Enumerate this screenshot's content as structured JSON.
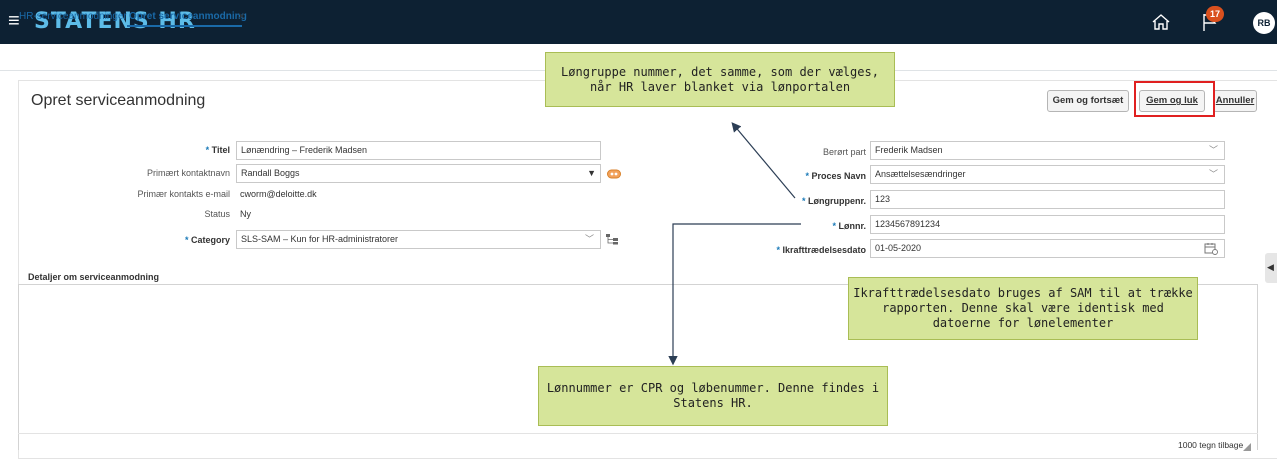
{
  "header": {
    "menu_icon": "hamburger-icon",
    "brand": "STATENS HR",
    "home_icon": "home-icon",
    "notification_icon": "flag-icon",
    "notification_count": "17",
    "user_initials": "RB",
    "colors": {
      "bar": "#0d2133",
      "brand": "#5dbce8",
      "badge": "#d9501e"
    }
  },
  "tabs": [
    {
      "label": "HR-serviceanmodninger"
    },
    {
      "label": "Opret serviceanmodning",
      "close": "×"
    }
  ],
  "page": {
    "title": "Opret serviceanmodning",
    "buttons": {
      "save_continue": "Gem og fortsæt",
      "save_close": "Gem og luk",
      "cancel": "Annuller"
    }
  },
  "form_left": {
    "title_label": "Titel",
    "title_value": "Lønændring – Frederik Madsen",
    "contact_label": "Primært kontaktnavn",
    "contact_value": "Randall Boggs",
    "email_label": "Primær kontakts e-mail",
    "email_value": "cworm@deloitte.dk",
    "status_label": "Status",
    "status_value": "Ny",
    "category_label": "Category",
    "category_value": "SLS-SAM – Kun for HR-administratorer"
  },
  "form_right": {
    "party_label": "Berørt part",
    "party_value": "Frederik Madsen",
    "process_label": "Proces Navn",
    "process_value": "Ansættelsesændringer",
    "salary_group_label": "Løngruppenr.",
    "salary_group_value": "123",
    "salary_no_label": "Lønnr.",
    "salary_no_value": "1234567891234",
    "effective_date_label": "Ikrafttrædelsesdato",
    "effective_date_value": "01-05-2020"
  },
  "details": {
    "label": "Detaljer om serviceanmodning",
    "counter": "1000 tegn tilbage"
  },
  "callouts": {
    "salary_group": "Løngruppe nummer, det samme, som der vælges, når HR laver blanket via lønportalen",
    "effective_date": "Ikrafttrædelsesdato bruges af SAM til at trække rapporten. Denne skal være identisk med datoerne for lønelementer",
    "salary_number": "Lønnummer er CPR og løbenummer. Denne findes i Statens HR."
  },
  "accent_colors": {
    "link": "#1a6aa8",
    "required": "#1a7ab8",
    "highlight": "#e02020",
    "callout": "#d6e59a"
  }
}
